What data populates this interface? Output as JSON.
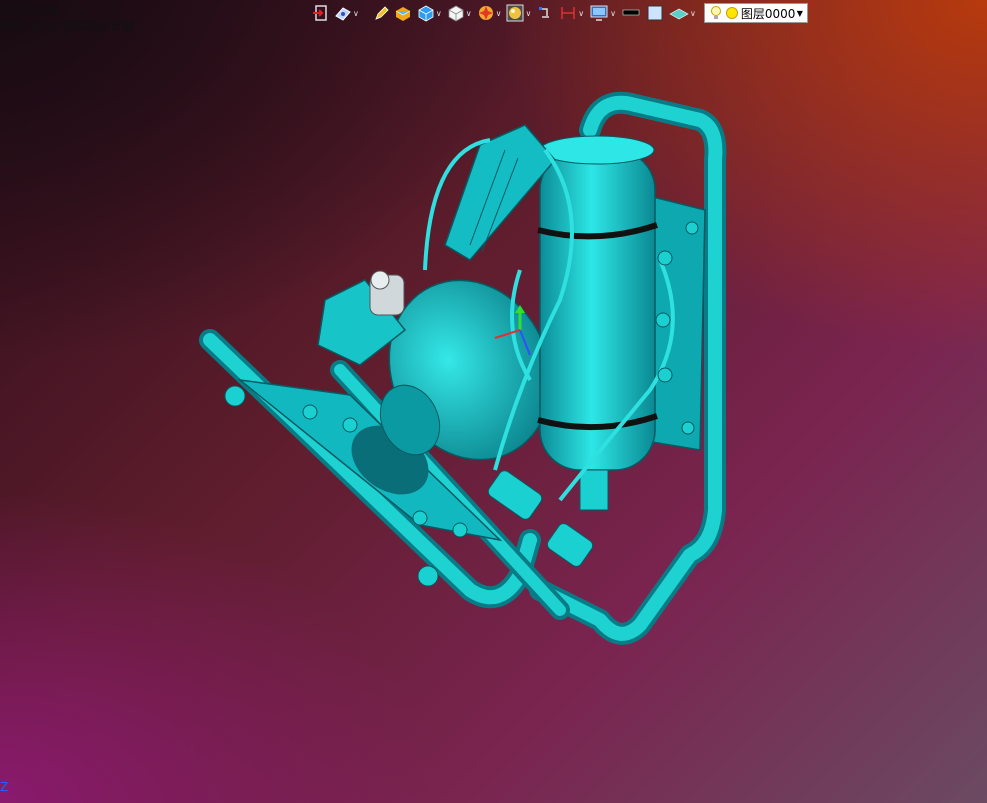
{
  "prompt": {
    "line1": "请拾取对象",
    "line2": "选择 '显示' 或编辑过滤器"
  },
  "toolbar": {
    "icons": [
      "exit-icon",
      "view-icon",
      "pencil-icon",
      "shaded-box-icon",
      "cube-blue-icon",
      "cube-white-icon",
      "render-icon",
      "material-sphere-icon",
      "rotate-icon",
      "dimension-icon",
      "monitor-icon",
      "line-style-icon",
      "color-swatch-icon",
      "plane-icon"
    ],
    "layer_label": "图层0000"
  },
  "axis": {
    "label": "Z"
  },
  "colors": {
    "model": "#14c4c4",
    "model_dark": "#0a7d86",
    "background_accent": "#b73a0c"
  }
}
